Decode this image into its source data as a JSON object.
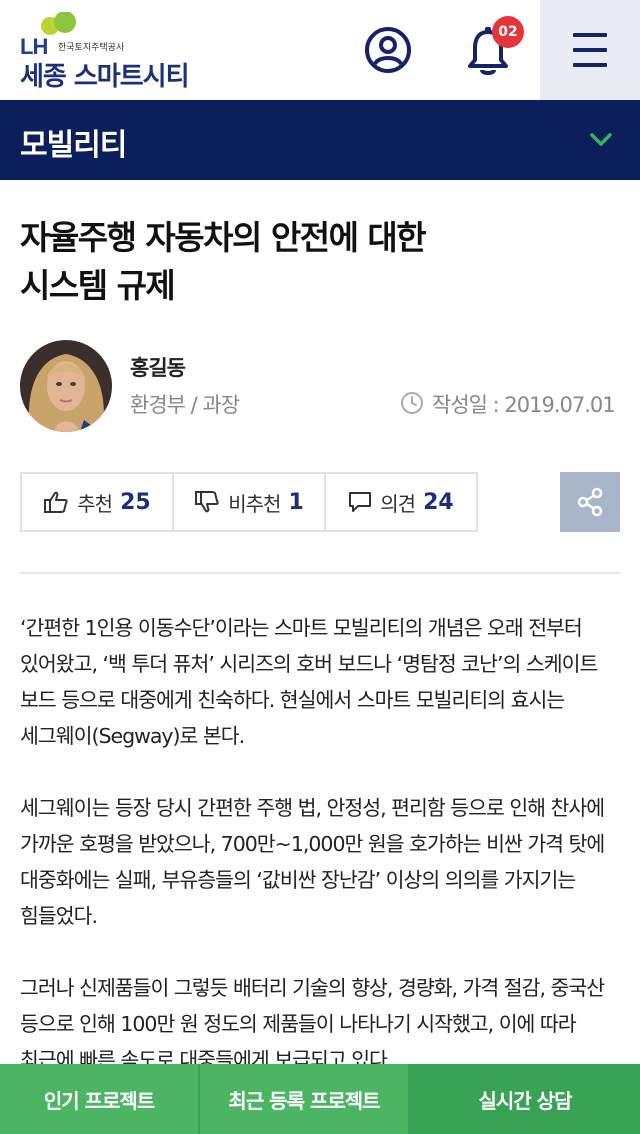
{
  "header": {
    "logo_lh": "LH",
    "logo_subtitle": "한국토지주택공사",
    "logo_title": "세종 스마트시티",
    "notification_count": "02",
    "colors": {
      "navy": "#1b2f7a",
      "badge": "#e5343a",
      "menu_bg": "#e9ecf3"
    }
  },
  "category": {
    "label": "모빌리티",
    "bg_color": "#0b1f5c",
    "chevron_color": "#3cb35a"
  },
  "article": {
    "title_line1": "자율주행 자동차의 안전에 대한",
    "title_line2": "시스템 규제",
    "author": {
      "name": "홍길동",
      "role": "환경부 / 과장"
    },
    "date_label": "작성일 : 2019.07.01",
    "reactions": [
      {
        "label": "추천",
        "count": "25",
        "icon": "thumbs-up-icon"
      },
      {
        "label": "비추천",
        "count": "1",
        "icon": "thumbs-down-icon"
      },
      {
        "label": "의견",
        "count": "24",
        "icon": "comment-icon"
      }
    ],
    "paragraphs": [
      "‘간편한 1인용 이동수단’이라는 스마트 모빌리티의 개념은 오래 전부터 있어왔고, ‘백 투더 퓨처’ 시리즈의 호버 보드나 ‘명탐정 코난’의 스케이트 보드 등으로 대중에게 친숙하다. 현실에서 스마트 모빌리티의 효시는 세그웨이(Segway)로 본다.",
      "세그웨이는 등장 당시 간편한 주행 법, 안정성, 편리함 등으로 인해 찬사에 가까운 호평을 받았으나, 700만~1,000만 원을 호가하는 비싼 가격 탓에 대중화에는 실패, 부유층들의 ‘값비싼 장난감’ 이상의 의의를 가지기는 힘들었다.",
      "그러나 신제품들이 그렇듯 배터리 기술의 향상, 경량화, 가격 절감, 중국산 등으로 인해 100만 원 정도의 제품들이 나타나기 시작했고, 이에 따라 최근에 빠른 속도로 대중들에게 보급되고 있다."
    ]
  },
  "bottom_nav": {
    "popular": "인기 프로젝트",
    "recent": "최근 등록 프로젝트",
    "consult": "실시간 상담",
    "colors": {
      "green": "#4bb564",
      "dark_green": "#38a355"
    }
  }
}
